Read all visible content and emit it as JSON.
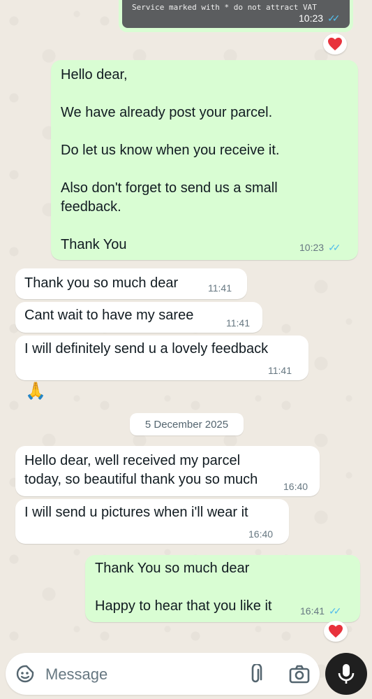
{
  "image_message": {
    "receipt_text": "Service marked with * do not attract VAT",
    "time": "10:23"
  },
  "messages": [
    {
      "direction": "out",
      "text": "Hello dear,\n\nWe have already post your parcel.\n\nDo let us know when you receive it.\n\nAlso don't forget to send us a small feedback.\n\nThank You",
      "time": "10:23",
      "read": true
    },
    {
      "direction": "in",
      "text": "Thank you so much dear",
      "time": "11:41"
    },
    {
      "direction": "in",
      "text": "Cant wait to have my saree",
      "time": "11:41"
    },
    {
      "direction": "in",
      "text": "I will definitely send u a lovely feedback",
      "time": "11:41"
    },
    {
      "direction": "in",
      "text": "🙏",
      "time": ""
    },
    {
      "direction": "in",
      "text": "Hello dear, well received my parcel today, so beautiful thank you so much",
      "time": "16:40"
    },
    {
      "direction": "in",
      "text": "I will send u pictures when i'll wear it",
      "time": "16:40"
    },
    {
      "direction": "out",
      "text": "Thank You so much dear\n\nHappy to hear that you like it",
      "time": "16:41",
      "read": true
    }
  ],
  "date_separator": "5 December 2025",
  "reactions": {
    "image": "heart",
    "last": "heart"
  },
  "composer": {
    "placeholder": "Message"
  },
  "colors": {
    "outgoing": "#d9fdd3",
    "incoming": "#ffffff",
    "read_ticks": "#53bdeb",
    "background": "#efeae2",
    "heart": "#e8323c"
  },
  "icons": [
    "sticker-icon",
    "attach-icon",
    "camera-icon",
    "mic-icon",
    "heart-icon",
    "read-ticks-icon"
  ]
}
